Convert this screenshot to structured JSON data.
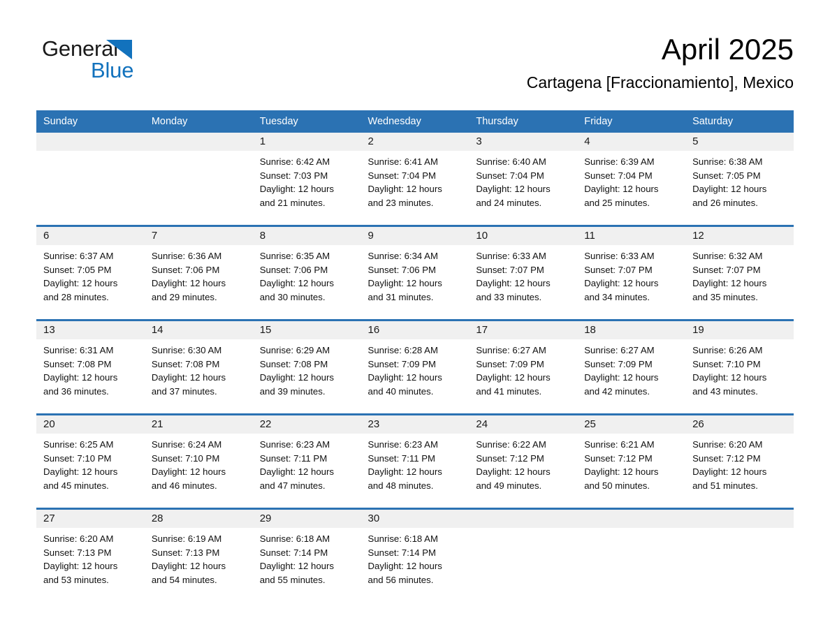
{
  "brand": {
    "name_part1": "General",
    "name_part2": "Blue",
    "triangle_color": "#1272bd"
  },
  "header": {
    "title": "April 2025",
    "subtitle": "Cartagena [Fraccionamiento], Mexico"
  },
  "colors": {
    "header_blue": "#2b72b3",
    "day_band_gray": "#f0f0f0",
    "text": "#000000"
  },
  "weekday_headers": [
    "Sunday",
    "Monday",
    "Tuesday",
    "Wednesday",
    "Thursday",
    "Friday",
    "Saturday"
  ],
  "weeks": [
    [
      {
        "day": "",
        "sunrise": "",
        "sunset": "",
        "daylight_line1": "",
        "daylight_line2": ""
      },
      {
        "day": "",
        "sunrise": "",
        "sunset": "",
        "daylight_line1": "",
        "daylight_line2": ""
      },
      {
        "day": "1",
        "sunrise": "Sunrise: 6:42 AM",
        "sunset": "Sunset: 7:03 PM",
        "daylight_line1": "Daylight: 12 hours",
        "daylight_line2": "and 21 minutes."
      },
      {
        "day": "2",
        "sunrise": "Sunrise: 6:41 AM",
        "sunset": "Sunset: 7:04 PM",
        "daylight_line1": "Daylight: 12 hours",
        "daylight_line2": "and 23 minutes."
      },
      {
        "day": "3",
        "sunrise": "Sunrise: 6:40 AM",
        "sunset": "Sunset: 7:04 PM",
        "daylight_line1": "Daylight: 12 hours",
        "daylight_line2": "and 24 minutes."
      },
      {
        "day": "4",
        "sunrise": "Sunrise: 6:39 AM",
        "sunset": "Sunset: 7:04 PM",
        "daylight_line1": "Daylight: 12 hours",
        "daylight_line2": "and 25 minutes."
      },
      {
        "day": "5",
        "sunrise": "Sunrise: 6:38 AM",
        "sunset": "Sunset: 7:05 PM",
        "daylight_line1": "Daylight: 12 hours",
        "daylight_line2": "and 26 minutes."
      }
    ],
    [
      {
        "day": "6",
        "sunrise": "Sunrise: 6:37 AM",
        "sunset": "Sunset: 7:05 PM",
        "daylight_line1": "Daylight: 12 hours",
        "daylight_line2": "and 28 minutes."
      },
      {
        "day": "7",
        "sunrise": "Sunrise: 6:36 AM",
        "sunset": "Sunset: 7:06 PM",
        "daylight_line1": "Daylight: 12 hours",
        "daylight_line2": "and 29 minutes."
      },
      {
        "day": "8",
        "sunrise": "Sunrise: 6:35 AM",
        "sunset": "Sunset: 7:06 PM",
        "daylight_line1": "Daylight: 12 hours",
        "daylight_line2": "and 30 minutes."
      },
      {
        "day": "9",
        "sunrise": "Sunrise: 6:34 AM",
        "sunset": "Sunset: 7:06 PM",
        "daylight_line1": "Daylight: 12 hours",
        "daylight_line2": "and 31 minutes."
      },
      {
        "day": "10",
        "sunrise": "Sunrise: 6:33 AM",
        "sunset": "Sunset: 7:07 PM",
        "daylight_line1": "Daylight: 12 hours",
        "daylight_line2": "and 33 minutes."
      },
      {
        "day": "11",
        "sunrise": "Sunrise: 6:33 AM",
        "sunset": "Sunset: 7:07 PM",
        "daylight_line1": "Daylight: 12 hours",
        "daylight_line2": "and 34 minutes."
      },
      {
        "day": "12",
        "sunrise": "Sunrise: 6:32 AM",
        "sunset": "Sunset: 7:07 PM",
        "daylight_line1": "Daylight: 12 hours",
        "daylight_line2": "and 35 minutes."
      }
    ],
    [
      {
        "day": "13",
        "sunrise": "Sunrise: 6:31 AM",
        "sunset": "Sunset: 7:08 PM",
        "daylight_line1": "Daylight: 12 hours",
        "daylight_line2": "and 36 minutes."
      },
      {
        "day": "14",
        "sunrise": "Sunrise: 6:30 AM",
        "sunset": "Sunset: 7:08 PM",
        "daylight_line1": "Daylight: 12 hours",
        "daylight_line2": "and 37 minutes."
      },
      {
        "day": "15",
        "sunrise": "Sunrise: 6:29 AM",
        "sunset": "Sunset: 7:08 PM",
        "daylight_line1": "Daylight: 12 hours",
        "daylight_line2": "and 39 minutes."
      },
      {
        "day": "16",
        "sunrise": "Sunrise: 6:28 AM",
        "sunset": "Sunset: 7:09 PM",
        "daylight_line1": "Daylight: 12 hours",
        "daylight_line2": "and 40 minutes."
      },
      {
        "day": "17",
        "sunrise": "Sunrise: 6:27 AM",
        "sunset": "Sunset: 7:09 PM",
        "daylight_line1": "Daylight: 12 hours",
        "daylight_line2": "and 41 minutes."
      },
      {
        "day": "18",
        "sunrise": "Sunrise: 6:27 AM",
        "sunset": "Sunset: 7:09 PM",
        "daylight_line1": "Daylight: 12 hours",
        "daylight_line2": "and 42 minutes."
      },
      {
        "day": "19",
        "sunrise": "Sunrise: 6:26 AM",
        "sunset": "Sunset: 7:10 PM",
        "daylight_line1": "Daylight: 12 hours",
        "daylight_line2": "and 43 minutes."
      }
    ],
    [
      {
        "day": "20",
        "sunrise": "Sunrise: 6:25 AM",
        "sunset": "Sunset: 7:10 PM",
        "daylight_line1": "Daylight: 12 hours",
        "daylight_line2": "and 45 minutes."
      },
      {
        "day": "21",
        "sunrise": "Sunrise: 6:24 AM",
        "sunset": "Sunset: 7:10 PM",
        "daylight_line1": "Daylight: 12 hours",
        "daylight_line2": "and 46 minutes."
      },
      {
        "day": "22",
        "sunrise": "Sunrise: 6:23 AM",
        "sunset": "Sunset: 7:11 PM",
        "daylight_line1": "Daylight: 12 hours",
        "daylight_line2": "and 47 minutes."
      },
      {
        "day": "23",
        "sunrise": "Sunrise: 6:23 AM",
        "sunset": "Sunset: 7:11 PM",
        "daylight_line1": "Daylight: 12 hours",
        "daylight_line2": "and 48 minutes."
      },
      {
        "day": "24",
        "sunrise": "Sunrise: 6:22 AM",
        "sunset": "Sunset: 7:12 PM",
        "daylight_line1": "Daylight: 12 hours",
        "daylight_line2": "and 49 minutes."
      },
      {
        "day": "25",
        "sunrise": "Sunrise: 6:21 AM",
        "sunset": "Sunset: 7:12 PM",
        "daylight_line1": "Daylight: 12 hours",
        "daylight_line2": "and 50 minutes."
      },
      {
        "day": "26",
        "sunrise": "Sunrise: 6:20 AM",
        "sunset": "Sunset: 7:12 PM",
        "daylight_line1": "Daylight: 12 hours",
        "daylight_line2": "and 51 minutes."
      }
    ],
    [
      {
        "day": "27",
        "sunrise": "Sunrise: 6:20 AM",
        "sunset": "Sunset: 7:13 PM",
        "daylight_line1": "Daylight: 12 hours",
        "daylight_line2": "and 53 minutes."
      },
      {
        "day": "28",
        "sunrise": "Sunrise: 6:19 AM",
        "sunset": "Sunset: 7:13 PM",
        "daylight_line1": "Daylight: 12 hours",
        "daylight_line2": "and 54 minutes."
      },
      {
        "day": "29",
        "sunrise": "Sunrise: 6:18 AM",
        "sunset": "Sunset: 7:14 PM",
        "daylight_line1": "Daylight: 12 hours",
        "daylight_line2": "and 55 minutes."
      },
      {
        "day": "30",
        "sunrise": "Sunrise: 6:18 AM",
        "sunset": "Sunset: 7:14 PM",
        "daylight_line1": "Daylight: 12 hours",
        "daylight_line2": "and 56 minutes."
      },
      {
        "day": "",
        "sunrise": "",
        "sunset": "",
        "daylight_line1": "",
        "daylight_line2": ""
      },
      {
        "day": "",
        "sunrise": "",
        "sunset": "",
        "daylight_line1": "",
        "daylight_line2": ""
      },
      {
        "day": "",
        "sunrise": "",
        "sunset": "",
        "daylight_line1": "",
        "daylight_line2": ""
      }
    ]
  ]
}
